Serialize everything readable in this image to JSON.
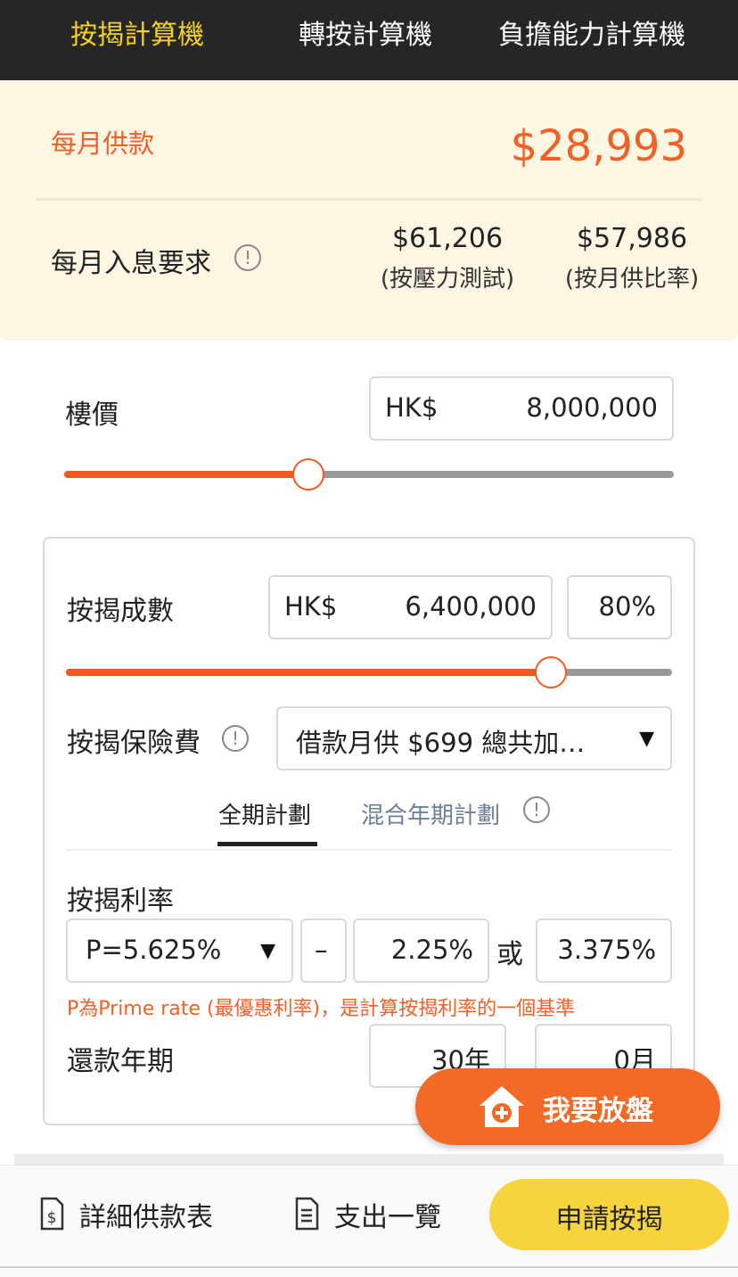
{
  "tabs": [
    {
      "label": "按揭計算機",
      "active": true
    },
    {
      "label": "轉按計算機",
      "active": false
    },
    {
      "label": "負擔能力計算機",
      "active": false
    }
  ],
  "summary": {
    "monthly_label": "每月供款",
    "monthly_value": "$28,993",
    "requirement_label": "每月入息要求",
    "stress_value": "$61,206",
    "stress_note": "(按壓力測試)",
    "ratio_value": "$57,986",
    "ratio_note": "(按月供比率)"
  },
  "price": {
    "label": "樓價",
    "currency": "HK$",
    "value": "8,000,000",
    "slider_fraction": 0.4
  },
  "loan": {
    "label": "按揭成數",
    "currency": "HK$",
    "amount": "6,400,000",
    "percent": "80%",
    "slider_fraction": 0.8
  },
  "insurance": {
    "label": "按揭保險費",
    "selected": "借款月供 $699 總共加…"
  },
  "plans": {
    "full": "全期計劃",
    "hybrid": "混合年期計劃"
  },
  "rate": {
    "label": "按揭利率",
    "prime": "P=5.625%",
    "operator": "–",
    "spread": "2.25%",
    "or": "或",
    "effective": "3.375%",
    "note": "P為Prime rate (最優惠利率)，是計算按揭利率的一個基準"
  },
  "term": {
    "label": "還款年期",
    "years": "30年",
    "months": "0月"
  },
  "fab": {
    "label": "我要放盤"
  },
  "bottom": {
    "schedule": "詳細供款表",
    "expenses": "支出一覽",
    "apply": "申請按揭"
  },
  "colors": {
    "accent_orange": "#ef6126",
    "tab_active": "#f5d21f",
    "apply_yellow": "#f5d43e"
  }
}
